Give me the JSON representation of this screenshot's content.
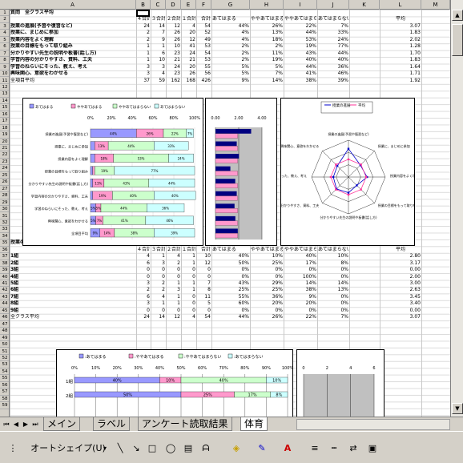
{
  "columns": [
    "A",
    "B",
    "C",
    "D",
    "E",
    "F",
    "G",
    "H",
    "I",
    "J",
    "K",
    "L",
    "M"
  ],
  "rows": [
    1,
    2,
    3,
    4,
    5,
    6,
    7,
    8,
    9,
    10,
    11,
    12,
    13,
    14,
    15,
    16,
    17,
    18,
    19,
    20,
    21,
    22,
    23,
    24,
    25,
    26,
    27,
    28,
    29,
    30,
    31,
    32,
    33,
    34,
    35,
    36,
    37,
    38,
    39,
    40,
    41,
    42,
    43,
    44,
    45,
    46,
    47,
    48,
    49,
    50,
    51,
    52,
    53,
    54,
    55,
    56,
    57,
    58,
    59
  ],
  "section1": {
    "title": "質問　全クラス平均",
    "headers": [
      "４合計",
      "３合計",
      "２合計",
      "１合計",
      "合計",
      "あてはまる",
      "ややあてはまる",
      "ややあてはまらない",
      "あてはまらない",
      "平均"
    ],
    "rows": [
      {
        "label": "授業の進展(予習や復習など)",
        "vals": [
          "24",
          "14",
          "12",
          "4",
          "54",
          "44%",
          "26%",
          "22%",
          "7%",
          "3.07"
        ]
      },
      {
        "label": "授業に、まじめに参加",
        "vals": [
          "2",
          "7",
          "26",
          "20",
          "52",
          "4%",
          "13%",
          "44%",
          "33%",
          "1.83"
        ]
      },
      {
        "label": "授業内容をよく理解",
        "vals": [
          "2",
          "9",
          "26",
          "12",
          "49",
          "4%",
          "18%",
          "53%",
          "24%",
          "2.02"
        ]
      },
      {
        "label": "授業の目標をもって取り組み",
        "vals": [
          "1",
          "1",
          "10",
          "41",
          "53",
          "2%",
          "2%",
          "19%",
          "77%",
          "1.28"
        ]
      },
      {
        "label": "分かりやすい先生の説明や板書(話し方)",
        "vals": [
          "1",
          "6",
          "23",
          "24",
          "54",
          "2%",
          "11%",
          "43%",
          "44%",
          "1.70"
        ]
      },
      {
        "label": "学習内容の分かりやすさ、資料、工夫",
        "vals": [
          "1",
          "10",
          "21",
          "21",
          "53",
          "2%",
          "19%",
          "40%",
          "40%",
          "1.83"
        ]
      },
      {
        "label": "学習のねらいにそった、教え、考え",
        "vals": [
          "3",
          "3",
          "24",
          "20",
          "55",
          "5%",
          "5%",
          "44%",
          "36%",
          "1.64"
        ]
      },
      {
        "label": "興味関心、意欲をわかせる",
        "vals": [
          "3",
          "4",
          "23",
          "26",
          "56",
          "5%",
          "7%",
          "41%",
          "46%",
          "1.71"
        ]
      },
      {
        "label": "全項目平均",
        "vals": [
          "37",
          "59",
          "162",
          "168",
          "426",
          "9%",
          "14%",
          "38%",
          "39%",
          "1.92"
        ]
      }
    ]
  },
  "chart1": {
    "legend": [
      "あてはまる",
      "ややあてはまる",
      "ややあてはまらない",
      "あてはまらない"
    ],
    "colors": [
      "#9999ff",
      "#ff99cc",
      "#ccffcc",
      "#ccffff"
    ],
    "ticks": [
      "0%",
      "20%",
      "40%",
      "60%",
      "80%",
      "100%"
    ],
    "categories": [
      "授業の進展(予習や復習など)",
      "授業に、まじめに参加",
      "授業内容をよく理解",
      "授業の目標をもって取り組み",
      "分かりやすい先生の説明や板書(話し方)",
      "学習内容の分かりやすさ、資料、工夫",
      "学習のねらいにそった、教え、考え",
      "興味関心、意欲をわかせる",
      "全項目平均"
    ]
  },
  "chart2": {
    "ticks": [
      "0.00",
      "2.00",
      "4.00"
    ]
  },
  "chart3": {
    "legend": [
      "授業の進展",
      "平均"
    ],
    "labels": [
      "授業の進展(予習や復習など)",
      "授業に、まじめに参加",
      "授業内容をよく理解",
      "授業の目標をもって取り組み",
      "分かりやすい先生の説明や板書(話し方)",
      "学習内容の分かりやすさ、資料、工夫",
      "学習のねらいにそった、教え、考え",
      "興味関心、意欲をわかせる"
    ]
  },
  "section2": {
    "title": "授業の進展(予習や復習など)",
    "headers": [
      "４合計",
      "３合計",
      "２合計",
      "１合計",
      "合計",
      "あてはまる",
      "ややあてはまる",
      "ややあてはまらない",
      "あてはまらない",
      "平均"
    ],
    "rows": [
      {
        "label": "1組",
        "vals": [
          "4",
          "1",
          "4",
          "1",
          "10",
          "40%",
          "10%",
          "40%",
          "10%",
          "2.80"
        ]
      },
      {
        "label": "2組",
        "vals": [
          "6",
          "3",
          "2",
          "1",
          "12",
          "50%",
          "25%",
          "17%",
          "8%",
          "3.17"
        ]
      },
      {
        "label": "3組",
        "vals": [
          "0",
          "0",
          "0",
          "0",
          "0",
          "0%",
          "0%",
          "0%",
          "0%",
          "0.00"
        ]
      },
      {
        "label": "4組",
        "vals": [
          "0",
          "0",
          "0",
          "0",
          "0",
          "0%",
          "0%",
          "100%",
          "0%",
          "2.00"
        ]
      },
      {
        "label": "5組",
        "vals": [
          "3",
          "2",
          "1",
          "1",
          "7",
          "43%",
          "29%",
          "14%",
          "14%",
          "3.00"
        ]
      },
      {
        "label": "6組",
        "vals": [
          "2",
          "2",
          "3",
          "1",
          "8",
          "25%",
          "25%",
          "38%",
          "13%",
          "2.63"
        ]
      },
      {
        "label": "7組",
        "vals": [
          "6",
          "4",
          "1",
          "0",
          "11",
          "55%",
          "36%",
          "9%",
          "0%",
          "3.45"
        ]
      },
      {
        "label": "8組",
        "vals": [
          "3",
          "1",
          "1",
          "0",
          "5",
          "60%",
          "20%",
          "20%",
          "0%",
          "3.40"
        ]
      },
      {
        "label": "9組",
        "vals": [
          "0",
          "0",
          "0",
          "0",
          "0",
          "0%",
          "0%",
          "0%",
          "0%",
          "0.00"
        ]
      },
      {
        "label": "全クラス平均",
        "vals": [
          "24",
          "14",
          "12",
          "4",
          "54",
          "44%",
          "26%",
          "22%",
          "7%",
          "3.07"
        ]
      }
    ]
  },
  "chart4": {
    "legend": [
      "あてはまる",
      "ややあてはまる",
      "ややあてはまらない",
      "あてはまらない"
    ],
    "ticks": [
      "0%",
      "10%",
      "20%",
      "30%",
      "40%",
      "50%",
      "60%",
      "70%",
      "80%",
      "90%",
      "100%"
    ],
    "rows": [
      "1組",
      "2組"
    ],
    "labels": [
      "40%",
      "10%",
      "40%",
      "10%",
      "50%",
      "25%",
      "17%",
      "8%"
    ]
  },
  "chart5": {
    "ticks": [
      "0",
      "2",
      "4",
      "6"
    ]
  },
  "tabs": [
    "メイン",
    "ラベル",
    "アンケート読取結果",
    "体育"
  ],
  "drawbar": {
    "autoshape": "オートシェイプ(U)"
  }
}
